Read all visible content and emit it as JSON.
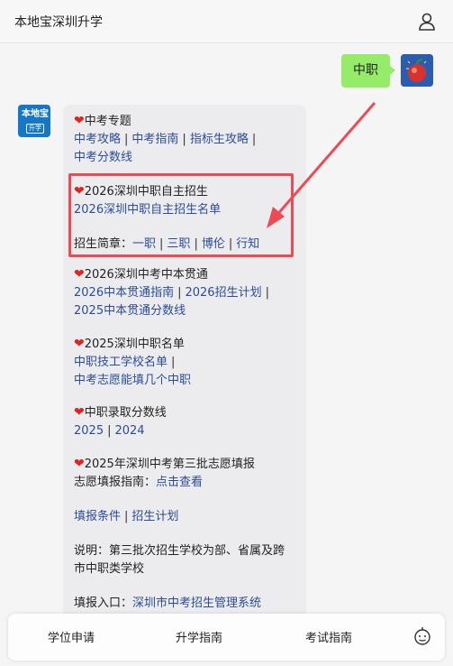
{
  "header": {
    "title": "本地宝深圳升学",
    "user_icon": "user-icon"
  },
  "user_message": {
    "text": "中职"
  },
  "bot_logo": {
    "line1": "本地宝",
    "line2": "升学"
  },
  "sections": {
    "s1": {
      "title": "中考专题",
      "links": [
        "中考攻略",
        "中考指南",
        "指标生攻略",
        "中考分数线"
      ]
    },
    "s2": {
      "title": "2026深圳中职自主招生",
      "link": "2026深圳中职自主招生名单",
      "label": "招生简章：",
      "schools": [
        "一职",
        "三职",
        "博伦",
        "行知"
      ]
    },
    "s3": {
      "title": "2026深圳中考中本贯通",
      "links": [
        "2026中本贯通指南",
        "2026招生计划",
        "2025中本贯通分数线"
      ]
    },
    "s4": {
      "title": "2025深圳中职名单",
      "links": [
        "中职技工学校名单",
        "中考志愿能填几个中职"
      ]
    },
    "s5": {
      "title": "中职录取分数线",
      "links": [
        "2025",
        "2024"
      ]
    },
    "s6": {
      "title": "2025年深圳中考第三批志愿填报",
      "guide_label": "志愿填报指南：",
      "guide_link": "点击查看",
      "links": [
        "填报条件",
        "招生计划"
      ],
      "note": "说明：第三批次招生学校为部、省属及跨市中职类学校",
      "entry_label": "填报入口：",
      "entry_link": "深圳市中考招生管理系统"
    }
  },
  "tabbar": {
    "items": [
      "学位申请",
      "升学指南",
      "考试指南"
    ]
  },
  "colors": {
    "link": "#2b4c9b",
    "highlight": "#ec4b55",
    "user_bubble": "#95ec69"
  }
}
